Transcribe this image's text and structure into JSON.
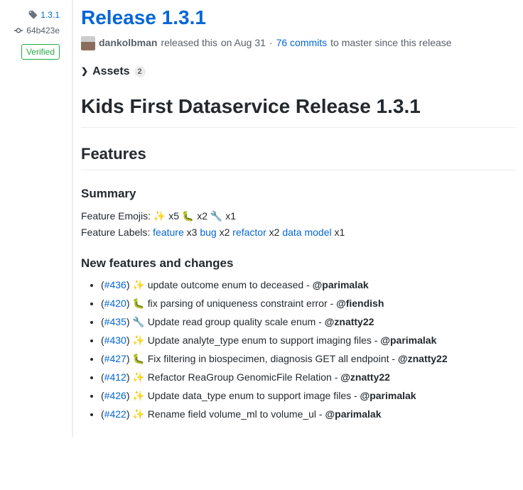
{
  "sidebar": {
    "tag": "1.3.1",
    "commit": "64b423e",
    "verified": "Verified"
  },
  "release": {
    "title": "Release 1.3.1",
    "author": "dankolbman",
    "action": "released this",
    "date": "on Aug 31",
    "commits_link_prefix": "76 commits",
    "commits_link_suffix": "to master since this release"
  },
  "assets": {
    "label": "Assets",
    "count": "2"
  },
  "body": {
    "h1": "Kids First Dataservice Release 1.3.1",
    "features_h2": "Features",
    "summary_h3": "Summary",
    "emoji_line_prefix": "Feature Emojis: ✨ x5 🐛 x2 🔧 x1",
    "labels_prefix": "Feature Labels:",
    "labels": [
      {
        "name": "feature",
        "count": "x3"
      },
      {
        "name": "bug",
        "count": "x2"
      },
      {
        "name": "refactor",
        "count": "x2"
      },
      {
        "name": "data model",
        "count": "x1"
      }
    ],
    "new_h3": "New features and changes",
    "changes": [
      {
        "issue": "#436",
        "emoji": "✨",
        "text": "update outcome enum to deceased",
        "author": "@parimalak"
      },
      {
        "issue": "#420",
        "emoji": "🐛",
        "text": "fix parsing of uniqueness constraint error",
        "author": "@fiendish"
      },
      {
        "issue": "#435",
        "emoji": "🔧",
        "text": "Update read group quality scale enum",
        "author": "@znatty22"
      },
      {
        "issue": "#430",
        "emoji": "✨",
        "text": "Update analyte_type enum to support imaging files",
        "author": "@parimalak"
      },
      {
        "issue": "#427",
        "emoji": "🐛",
        "text": "Fix filtering in biospecimen, diagnosis GET all endpoint",
        "author": "@znatty22"
      },
      {
        "issue": "#412",
        "emoji": "✨",
        "text": "Refactor ReaGroup GenomicFile Relation",
        "author": "@znatty22"
      },
      {
        "issue": "#426",
        "emoji": "✨",
        "text": "Update data_type enum to support image files",
        "author": "@parimalak"
      },
      {
        "issue": "#422",
        "emoji": "✨",
        "text": "Rename field volume_ml to volume_ul",
        "author": "@parimalak"
      }
    ]
  }
}
